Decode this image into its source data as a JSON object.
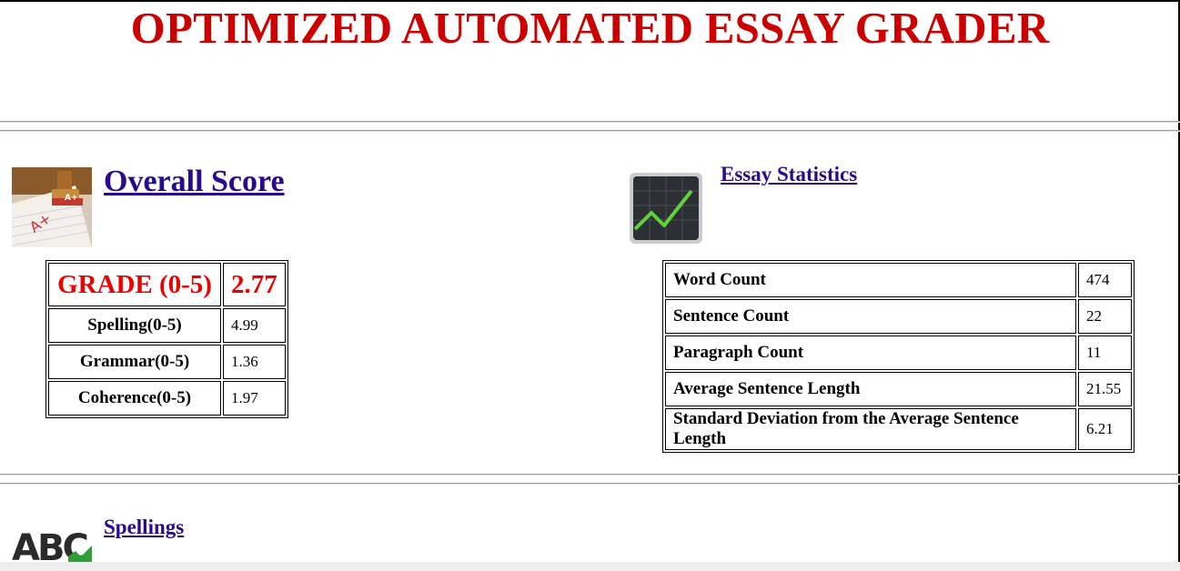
{
  "page": {
    "title": "OPTIMIZED AUTOMATED ESSAY GRADER"
  },
  "overall": {
    "heading": "Overall Score",
    "image_icon": "grade-stamp-icon",
    "grade_label": "GRADE (0-5)",
    "grade_value": "2.77",
    "rows": [
      {
        "label": "Spelling(0-5)",
        "value": "4.99"
      },
      {
        "label": "Grammar(0-5)",
        "value": "1.36"
      },
      {
        "label": "Coherence(0-5)",
        "value": "1.97"
      }
    ]
  },
  "statistics": {
    "heading": "Essay Statistics",
    "image_icon": "monitor-chart-icon",
    "rows": [
      {
        "label": "Word Count",
        "value": "474"
      },
      {
        "label": "Sentence Count",
        "value": "22"
      },
      {
        "label": "Paragraph Count",
        "value": "11"
      },
      {
        "label": "Average Sentence Length",
        "value": "21.55"
      },
      {
        "label": "Standard Deviation from the Average Sentence Length",
        "value": "6.21"
      }
    ]
  },
  "spellings": {
    "heading": "Spellings",
    "image_icon": "abc-check-icon"
  },
  "colors": {
    "title": "#cc0000",
    "grade": "#ee0000",
    "link": "#2a0a8a"
  }
}
